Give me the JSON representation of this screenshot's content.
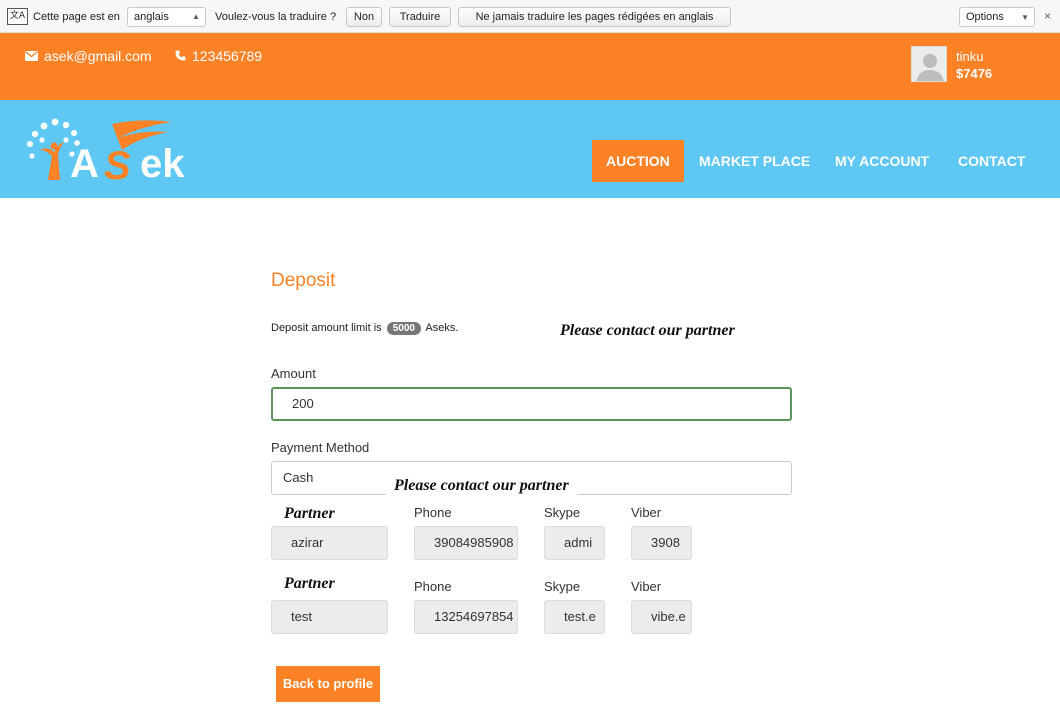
{
  "translate_bar": {
    "prefix": "Cette page est en",
    "language": "anglais",
    "question": "Voulez-vous la traduire ?",
    "no_label": "Non",
    "translate_label": "Traduire",
    "never_label": "Ne jamais traduire les pages rédigées en anglais",
    "options_label": "Options",
    "icon_glyph": "文A",
    "close_glyph": "×"
  },
  "topbar": {
    "email": "asek@gmail.com",
    "phone": "123456789",
    "username": "tinku",
    "balance": "$7476"
  },
  "brand": {
    "logo_a": "A",
    "logo_s": "S",
    "logo_ek": "ek"
  },
  "nav": {
    "auction": "AUCTION",
    "market_place": "MARKET PLACE",
    "my_account": "MY ACCOUNT",
    "contact": "CONTACT"
  },
  "deposit": {
    "title": "Deposit",
    "limit_prefix": "Deposit amount limit is",
    "limit_value": "5000",
    "limit_suffix": "Aseks.",
    "partner_message": "Please contact our partner",
    "amount_label": "Amount",
    "amount_value": "200",
    "method_label": "Payment Method",
    "method_value": "Cash",
    "overlay_message": "Please contact our partner",
    "back_label": "Back to profile"
  },
  "partners": [
    {
      "label": "Partner",
      "phone_label": "Phone",
      "skype_label": "Skype",
      "viber_label": "Viber",
      "name": "azirar",
      "phone": "39084985908",
      "skype": "admi",
      "viber": "3908"
    },
    {
      "label": "Partner",
      "phone_label": "Phone",
      "skype_label": "Skype",
      "viber_label": "Viber",
      "name": "test",
      "phone": "13254697854",
      "skype": "test.e",
      "viber": "vibe.e"
    }
  ],
  "colors": {
    "orange": "#fd8226",
    "blue": "#5ec7f4",
    "focus_green": "#5c955c"
  }
}
